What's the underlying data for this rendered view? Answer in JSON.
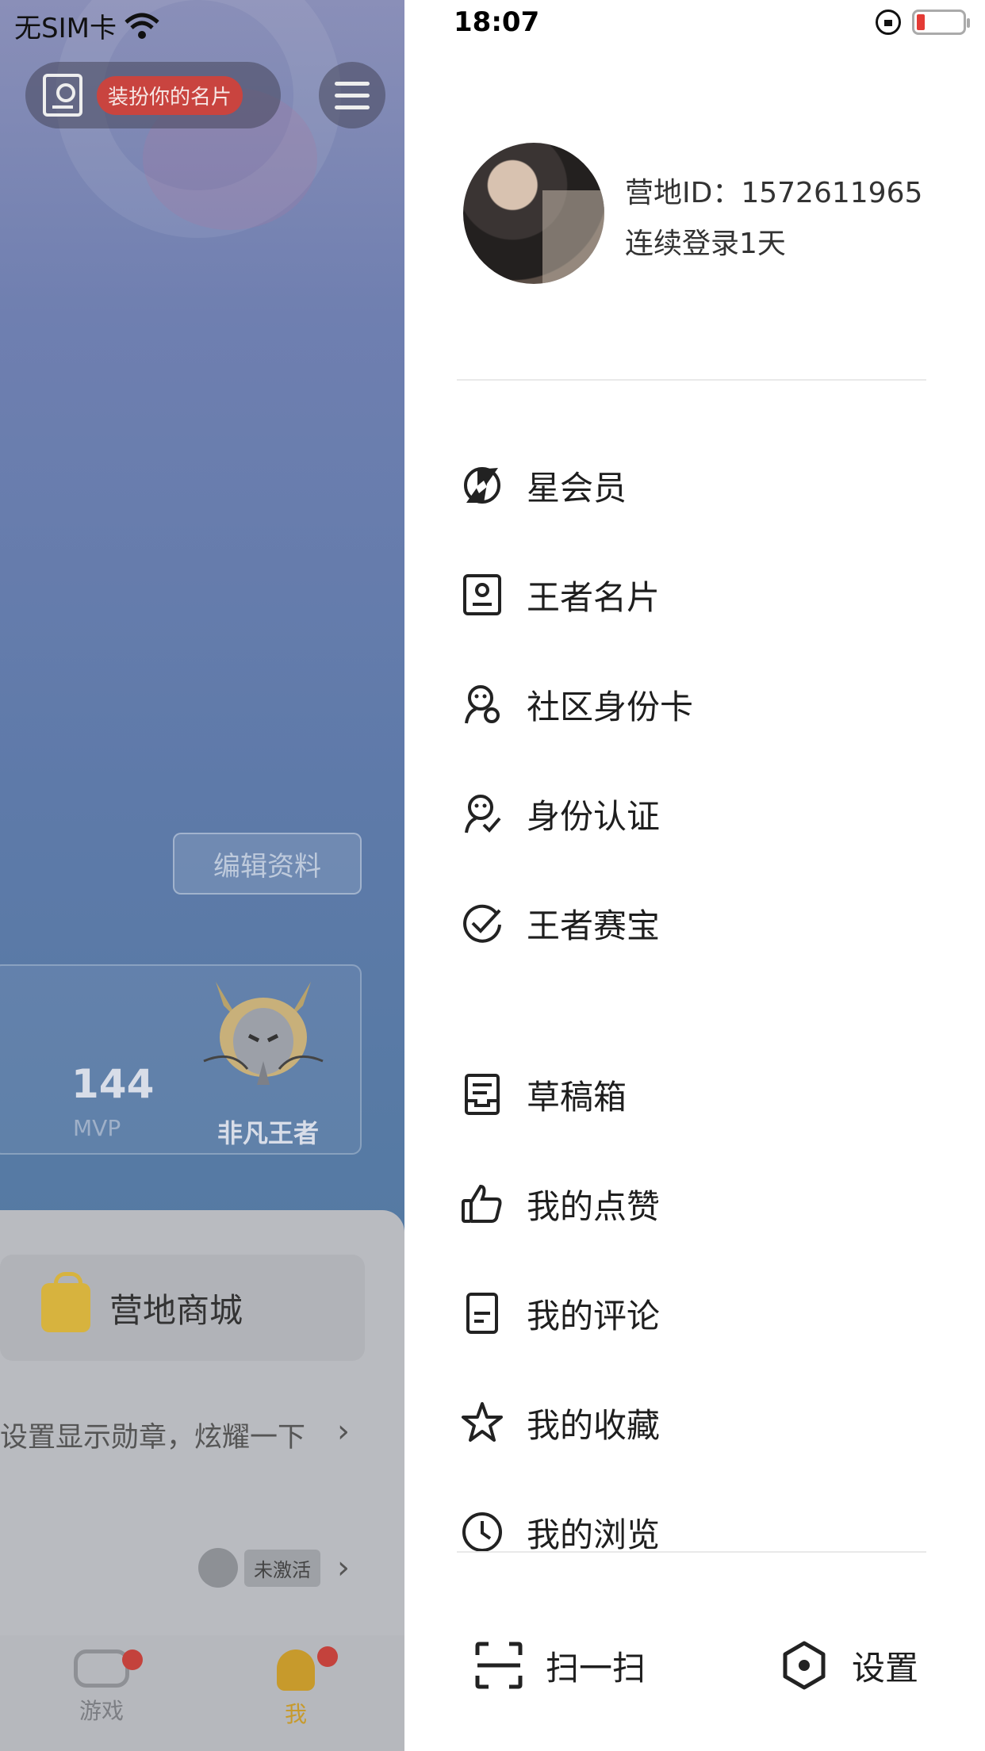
{
  "background_page": {
    "status": {
      "carrier": "无SIM卡"
    },
    "card_pill": {
      "tag": "装扮你的名片"
    },
    "edit_profile": "编辑资料",
    "stats": {
      "mvp_value": "144",
      "mvp_label": "MVP",
      "rank_label": "非凡王者"
    },
    "shop_label": "营地商城",
    "medal_prompt": "设置显示勋章，炫耀一下",
    "inactive_badge": "未激活",
    "tabs": [
      {
        "label": "游戏"
      },
      {
        "label": "我"
      }
    ]
  },
  "drawer": {
    "status": {
      "time": "18:07"
    },
    "profile": {
      "camp_id": "营地ID：1572611965",
      "login_streak": "连续登录1天"
    },
    "menu_group_1": [
      {
        "label": "星会员",
        "icon": "star-member-icon"
      },
      {
        "label": "王者名片",
        "icon": "id-card-icon"
      },
      {
        "label": "社区身份卡",
        "icon": "community-id-icon"
      },
      {
        "label": "身份认证",
        "icon": "verify-icon"
      },
      {
        "label": "王者赛宝",
        "icon": "check-circle-icon"
      }
    ],
    "menu_group_2": [
      {
        "label": "草稿箱",
        "icon": "drafts-icon"
      },
      {
        "label": "我的点赞",
        "icon": "thumbs-up-icon"
      },
      {
        "label": "我的评论",
        "icon": "comment-icon"
      },
      {
        "label": "我的收藏",
        "icon": "star-icon"
      },
      {
        "label": "我的浏览",
        "icon": "clock-icon"
      }
    ],
    "bottom": {
      "scan": "扫一扫",
      "settings": "设置"
    }
  }
}
